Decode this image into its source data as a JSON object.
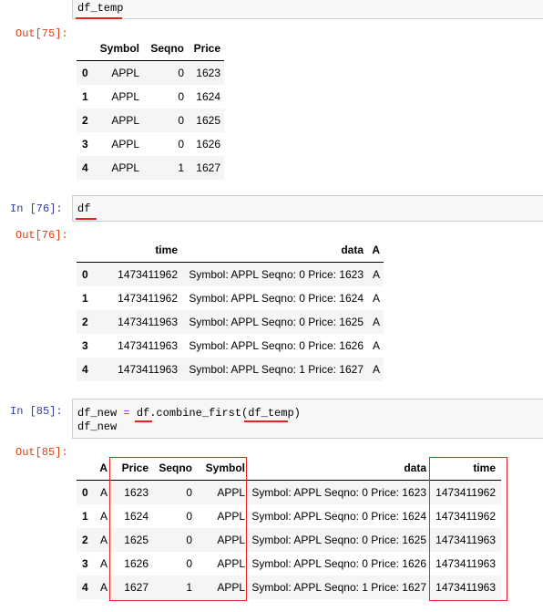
{
  "cell75": {
    "code": "df_temp",
    "out_prompt": "Out[75]:",
    "columns": [
      "Symbol",
      "Seqno",
      "Price"
    ],
    "rows": [
      {
        "idx": "0",
        "cells": [
          "APPL",
          "0",
          "1623"
        ]
      },
      {
        "idx": "1",
        "cells": [
          "APPL",
          "0",
          "1624"
        ]
      },
      {
        "idx": "2",
        "cells": [
          "APPL",
          "0",
          "1625"
        ]
      },
      {
        "idx": "3",
        "cells": [
          "APPL",
          "0",
          "1626"
        ]
      },
      {
        "idx": "4",
        "cells": [
          "APPL",
          "1",
          "1627"
        ]
      }
    ]
  },
  "cell76": {
    "in_prompt": "In  [76]:",
    "code": "df",
    "out_prompt": "Out[76]:",
    "columns": [
      "time",
      "data",
      "A"
    ],
    "rows": [
      {
        "idx": "0",
        "cells": [
          "1473411962",
          "Symbol: APPL Seqno: 0 Price: 1623",
          "A"
        ]
      },
      {
        "idx": "1",
        "cells": [
          "1473411962",
          "Symbol: APPL Seqno: 0 Price: 1624",
          "A"
        ]
      },
      {
        "idx": "2",
        "cells": [
          "1473411963",
          "Symbol: APPL Seqno: 0 Price: 1625",
          "A"
        ]
      },
      {
        "idx": "3",
        "cells": [
          "1473411963",
          "Symbol: APPL Seqno: 0 Price: 1626",
          "A"
        ]
      },
      {
        "idx": "4",
        "cells": [
          "1473411963",
          "Symbol: APPL Seqno: 1 Price: 1627",
          "A"
        ]
      }
    ]
  },
  "cell85": {
    "in_prompt": "In  [85]:",
    "code_line1_a": "df_new ",
    "code_line1_eq": "=",
    "code_line1_b": " df.combine_first(df_temp)",
    "code_line2": "df_new",
    "out_prompt": "Out[85]:",
    "columns": [
      "A",
      "Price",
      "Seqno",
      "Symbol",
      "data",
      "time"
    ],
    "rows": [
      {
        "idx": "0",
        "cells": [
          "A",
          "1623",
          "0",
          "APPL",
          "Symbol: APPL Seqno: 0 Price: 1623",
          "1473411962"
        ]
      },
      {
        "idx": "1",
        "cells": [
          "A",
          "1624",
          "0",
          "APPL",
          "Symbol: APPL Seqno: 0 Price: 1624",
          "1473411962"
        ]
      },
      {
        "idx": "2",
        "cells": [
          "A",
          "1625",
          "0",
          "APPL",
          "Symbol: APPL Seqno: 0 Price: 1625",
          "1473411963"
        ]
      },
      {
        "idx": "3",
        "cells": [
          "A",
          "1626",
          "0",
          "APPL",
          "Symbol: APPL Seqno: 0 Price: 1626",
          "1473411963"
        ]
      },
      {
        "idx": "4",
        "cells": [
          "A",
          "1627",
          "1",
          "APPL",
          "Symbol: APPL Seqno: 1 Price: 1627",
          "1473411963"
        ]
      }
    ]
  },
  "colors": {
    "annotation": "#e8231f",
    "in_prompt": "#303f9f",
    "out_prompt": "#d84315"
  }
}
